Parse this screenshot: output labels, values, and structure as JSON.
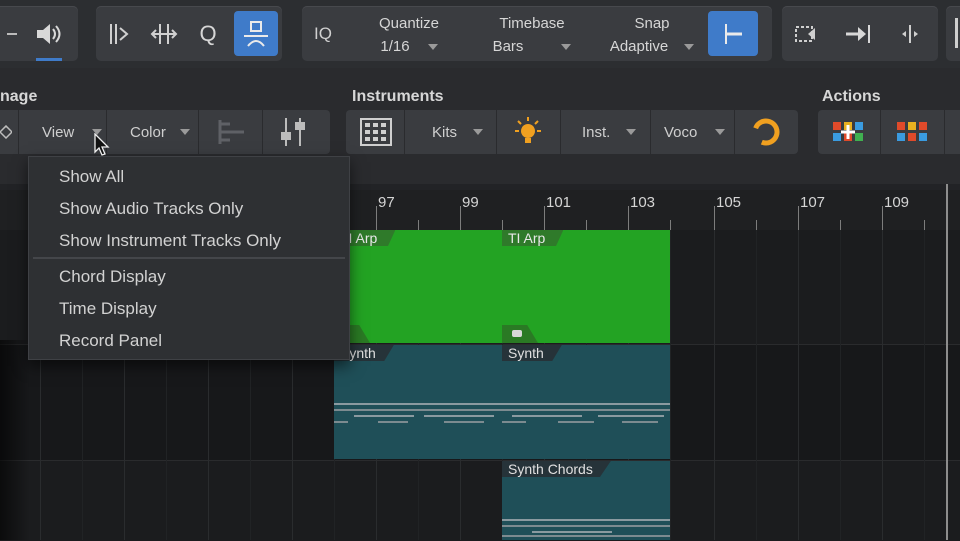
{
  "transport": {
    "iq_label": "IQ",
    "quantize": {
      "label": "Quantize",
      "value": "1/16"
    },
    "timebase": {
      "label": "Timebase",
      "value": "Bars"
    },
    "snap": {
      "label": "Snap",
      "value": "Adaptive"
    },
    "accent_color": "#3f7bc9"
  },
  "toolbar": {
    "left_section_label": "nage",
    "view_label": "View",
    "color_label": "Color",
    "instruments_title": "Instruments",
    "kits_label": "Kits",
    "inst_label": "Inst.",
    "voco_label": "Voco",
    "actions_title": "Actions"
  },
  "ruler": {
    "bars": [
      "97",
      "99",
      "101",
      "103",
      "105",
      "107",
      "109"
    ]
  },
  "clips": [
    {
      "name": "TI Arp"
    },
    {
      "name": "TI Arp"
    },
    {
      "name": "Synth"
    },
    {
      "name": "Synth"
    },
    {
      "name": "Synth Chords"
    }
  ],
  "view_menu": {
    "items": [
      "Show All",
      "Show Audio Tracks Only",
      "Show Instrument Tracks Only",
      "Chord Display",
      "Time Display",
      "Record Panel"
    ]
  },
  "colors": {
    "clip_green": "#23a323",
    "clip_teal": "#1f4f58"
  }
}
